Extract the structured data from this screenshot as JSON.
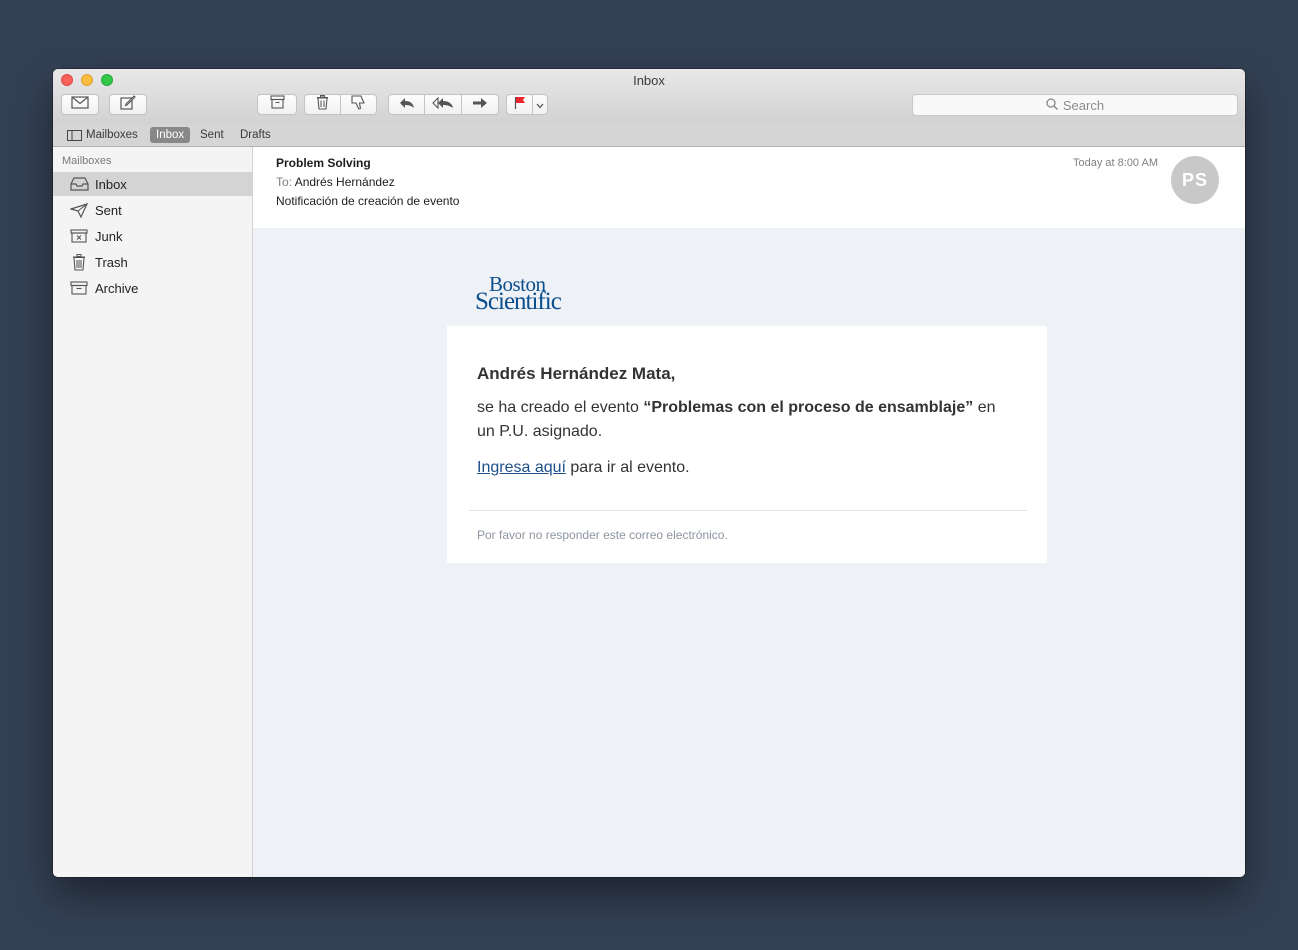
{
  "window": {
    "title": "Inbox"
  },
  "toolbar": {
    "search_placeholder": "Search"
  },
  "favorites": {
    "mailboxes_label": "Mailboxes",
    "inbox_label": "Inbox",
    "sent_label": "Sent",
    "drafts_label": "Drafts"
  },
  "sidebar": {
    "heading": "Mailboxes",
    "items": [
      {
        "label": "Inbox",
        "icon": "inbox-icon"
      },
      {
        "label": "Sent",
        "icon": "paper-plane-icon"
      },
      {
        "label": "Junk",
        "icon": "junk-icon"
      },
      {
        "label": "Trash",
        "icon": "trash-icon"
      },
      {
        "label": "Archive",
        "icon": "archive-icon"
      }
    ]
  },
  "message": {
    "from": "Problem Solving",
    "to_label": "To:",
    "to": "Andrés Hernández",
    "subject": "Notificación de creación de evento",
    "date": "Today at 8:00 AM",
    "avatar_initials": "PS"
  },
  "email": {
    "logo_line1": "Boston",
    "logo_line2": "Scientific",
    "greeting": "Andrés Hernández Mata,",
    "body_prefix": "se ha creado el evento ",
    "event_name": "“Problemas con el proceso de ensamblaje”",
    "body_suffix": " en un P.U. asignado.",
    "link_text": "Ingresa aquí",
    "link_suffix": " para ir al evento.",
    "footer": "Por favor no responder este correo electrónico."
  },
  "colors": {
    "desktop": "#344154",
    "brand_blue": "#0b4f8e",
    "flag_red": "#e8262b"
  }
}
